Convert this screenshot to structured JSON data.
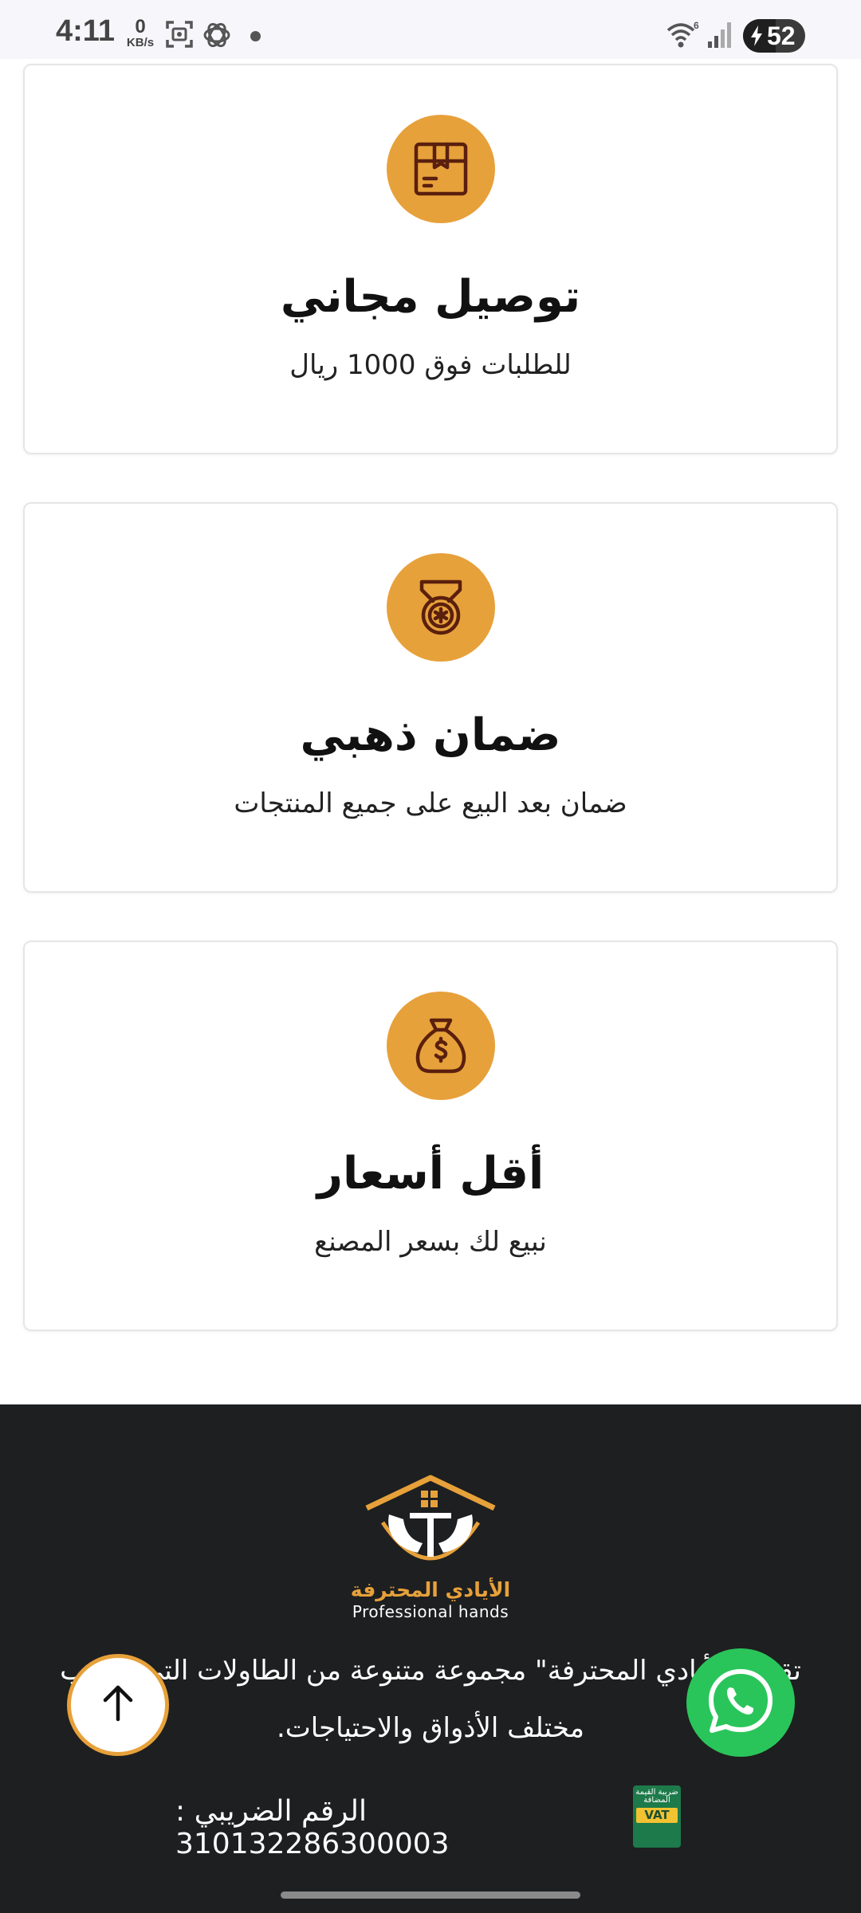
{
  "status_bar": {
    "time": "4:11",
    "net_speed_value": "0",
    "net_speed_unit": "KB/s",
    "battery_percent": "52",
    "battery_level": 0.52,
    "icons": [
      "screenshot-icon",
      "chatgpt-icon",
      "notification-dot",
      "wifi-icon",
      "signal-icon",
      "battery-icon"
    ]
  },
  "features": [
    {
      "icon": "box-icon",
      "title": "توصيل مجاني",
      "subtitle": "للطلبات فوق 1000 ريال"
    },
    {
      "icon": "medal-icon",
      "title": "ضمان ذهبي",
      "subtitle": "ضمان بعد البيع على جميع المنتجات"
    },
    {
      "icon": "money-bag-icon",
      "title": "أقل أسعار",
      "subtitle": "نبيع لك بسعر المصنع"
    }
  ],
  "footer": {
    "logo_ar": "الأيادي المحترفة",
    "logo_en": "Professional hands",
    "description": "تقدم \"الأيادي المحترفة\" مجموعة متنوعة من الطاولات التي تناسب مختلف الأذواق والاحتياجات.",
    "tax_label": "الرقم الضريبي : 310132286300003",
    "vat_badge_ar": "ضريبة القيمة المضافة",
    "vat_badge_label": "VAT"
  },
  "floating": {
    "scroll_top_icon": "arrow-up-icon",
    "whatsapp_icon": "whatsapp-icon"
  },
  "colors": {
    "accent": "#e7a13a",
    "footer_bg": "#1e1f20",
    "whatsapp": "#2ac55a",
    "icon_stroke": "#5a1f0d"
  }
}
